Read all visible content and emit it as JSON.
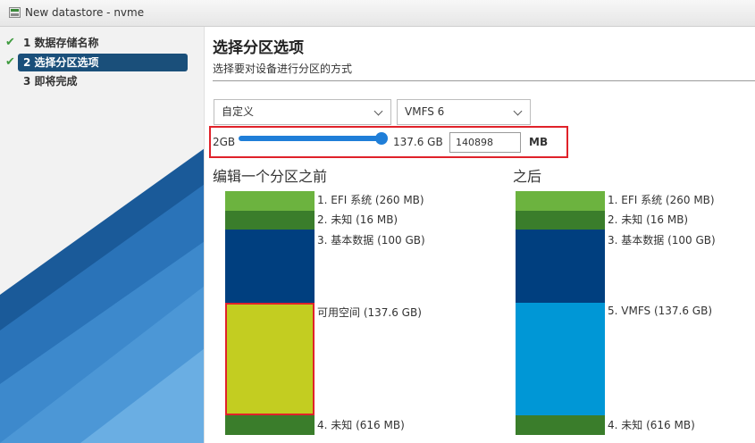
{
  "window": {
    "title": "New datastore - nvme",
    "icon": "datastore-icon"
  },
  "nav": {
    "steps": [
      {
        "label": "1 数据存储名称",
        "completed": true
      },
      {
        "label": "2 选择分区选项",
        "completed": true,
        "active": true
      },
      {
        "label": "3 即将完成",
        "completed": false
      }
    ]
  },
  "main": {
    "title": "选择分区选项",
    "subtitle": "选择要对设备进行分区的方式",
    "partition_scheme": {
      "selected": "自定义"
    },
    "filesystem": {
      "selected": "VMFS 6"
    },
    "size": {
      "min_label": "2GB",
      "max_label": "137.6 GB",
      "value": "140898",
      "unit": "MB",
      "slider_fraction": 1.0
    },
    "before": {
      "title": "编辑一个分区之前",
      "partitions": [
        {
          "label": "1. EFI 系统 (260 MB)",
          "color": "#6cb33f"
        },
        {
          "label": "2. 未知 (16 MB)",
          "color": "#3a7d2b"
        },
        {
          "label": "3. 基本数据 (100 GB)",
          "color": "#003f7f"
        },
        {
          "label": "可用空间 (137.6 GB)",
          "color": "#c3cd21",
          "highlight": "#e0222a"
        },
        {
          "label": "4. 未知 (616 MB)",
          "color": "#3a7d2b"
        }
      ]
    },
    "after": {
      "title": "之后",
      "partitions": [
        {
          "label": "1. EFI 系统 (260 MB)",
          "color": "#6cb33f"
        },
        {
          "label": "2. 未知 (16 MB)",
          "color": "#3a7d2b"
        },
        {
          "label": "3. 基本数据 (100 GB)",
          "color": "#003f7f"
        },
        {
          "label": "5. VMFS (137.6 GB)",
          "color": "#0097d6"
        },
        {
          "label": "4. 未知 (616 MB)",
          "color": "#3a7d2b"
        }
      ]
    }
  }
}
